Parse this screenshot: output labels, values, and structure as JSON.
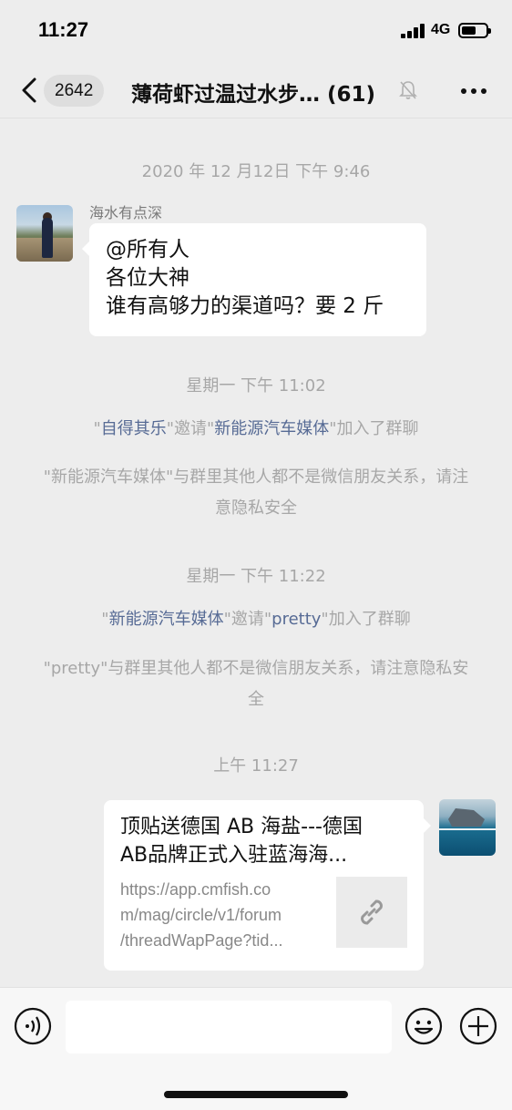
{
  "status_bar": {
    "time": "11:27",
    "network": "4G"
  },
  "header": {
    "unread_count": "2642",
    "title": "薄荷虾过温过水步… (61)",
    "icons": [
      "back-icon",
      "mute-icon",
      "more-icon"
    ]
  },
  "messages": {
    "ts1": "2020 年 12 月12日 下午 9:46",
    "msg1": {
      "sender": "海水有点深",
      "lines": [
        "@所有人",
        "各位大神",
        "谁有高够力的渠道吗？要 2 斤"
      ]
    },
    "ts2": "星期一 下午 11:02",
    "sys1": {
      "q1": "\"",
      "inviter": "自得其乐",
      "mid": "\"邀请\"",
      "invitee": "新能源汽车媒体",
      "end": "\"加入了群聊"
    },
    "sys2": "\"新能源汽车媒体\"与群里其他人都不是微信朋友关系，请注意隐私安全",
    "ts3": "星期一 下午 11:22",
    "sys3": {
      "q1": "\"",
      "inviter": "新能源汽车媒体",
      "mid": "\"邀请\"",
      "invitee": "pretty",
      "end": "\"加入了群聊"
    },
    "sys4": "\"pretty\"与群里其他人都不是微信朋友关系，请注意隐私安全",
    "ts4": "上午 11:27",
    "link_card": {
      "title_line1": "顶贴送德国 AB 海盐---德国",
      "title_line2": "AB品牌正式入驻蓝海海...",
      "desc_line1": "https://app.cmfish.co",
      "desc_line2": "m/mag/circle/v1/forum",
      "desc_line3": "/threadWapPage?tid...",
      "thumb_icon": "link-icon"
    }
  },
  "input_bar": {
    "placeholder": "",
    "icons": [
      "voice-icon",
      "emoji-icon",
      "plus-icon"
    ]
  },
  "colors": {
    "background": "#ededed",
    "bubble": "#ffffff",
    "system_link": "#576b95",
    "system_text": "#a7a7a7"
  }
}
